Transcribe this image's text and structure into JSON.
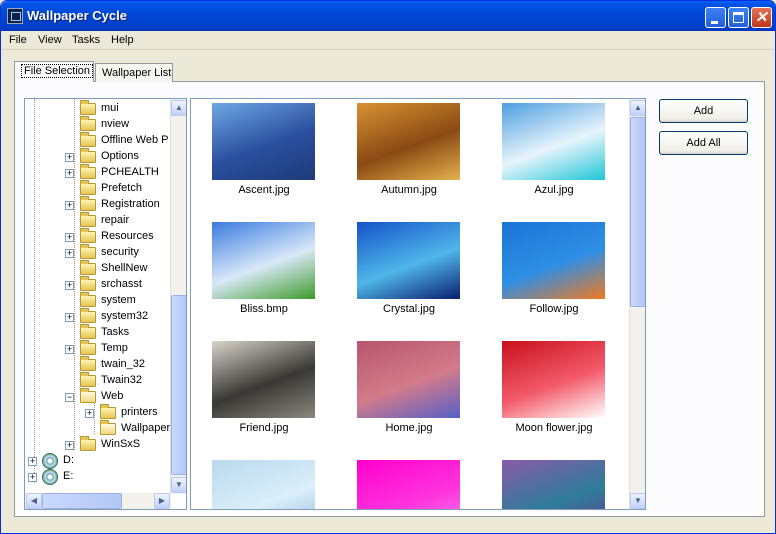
{
  "window": {
    "title": "Wallpaper Cycle"
  },
  "titlebar": {
    "icons": [
      "minimize-icon",
      "maximize-icon",
      "close-icon"
    ]
  },
  "menu": [
    "File",
    "View",
    "Tasks",
    "Help"
  ],
  "tabs": [
    {
      "label": "File Selection",
      "active": true
    },
    {
      "label": "Wallpaper List",
      "active": false
    }
  ],
  "tree": {
    "items": [
      {
        "label": "mui",
        "expandable": false
      },
      {
        "label": "nview",
        "expandable": false
      },
      {
        "label": "Offline Web P",
        "expandable": false
      },
      {
        "label": "Options",
        "expandable": true
      },
      {
        "label": "PCHEALTH",
        "expandable": true
      },
      {
        "label": "Prefetch",
        "expandable": false
      },
      {
        "label": "Registration",
        "expandable": true
      },
      {
        "label": "repair",
        "expandable": false
      },
      {
        "label": "Resources",
        "expandable": true
      },
      {
        "label": "security",
        "expandable": true
      },
      {
        "label": "ShellNew",
        "expandable": false
      },
      {
        "label": "srchasst",
        "expandable": true
      },
      {
        "label": "system",
        "expandable": false
      },
      {
        "label": "system32",
        "expandable": true
      },
      {
        "label": "Tasks",
        "expandable": false
      },
      {
        "label": "Temp",
        "expandable": true
      },
      {
        "label": "twain_32",
        "expandable": false
      },
      {
        "label": "Twain32",
        "expandable": false
      },
      {
        "label": "Web",
        "expandable": true,
        "expanded": true
      },
      {
        "label": "printers",
        "expandable": true,
        "child": true
      },
      {
        "label": "Wallpaper",
        "expandable": false,
        "child": true,
        "open": true
      },
      {
        "label": "WinSxS",
        "expandable": true
      }
    ],
    "drives": [
      {
        "label": "D:"
      },
      {
        "label": "E:"
      }
    ]
  },
  "gallery": {
    "images": [
      {
        "name": "Ascent.jpg",
        "colors": [
          "#6fa7e6",
          "#2a4f9d",
          "#1e3b7a"
        ]
      },
      {
        "name": "Autumn.jpg",
        "colors": [
          "#d89233",
          "#8a4a14",
          "#e5b24c"
        ]
      },
      {
        "name": "Azul.jpg",
        "colors": [
          "#4d9ee0",
          "#e8f4fb",
          "#1ec6d8"
        ]
      },
      {
        "name": "Bliss.bmp",
        "colors": [
          "#3a7be0",
          "#d9e8f7",
          "#3e9a2a"
        ]
      },
      {
        "name": "Crystal.jpg",
        "colors": [
          "#1552c9",
          "#4fb6e8",
          "#0a1f6e"
        ]
      },
      {
        "name": "Follow.jpg",
        "colors": [
          "#1a74d6",
          "#2f8fe4",
          "#f07a1f"
        ]
      },
      {
        "name": "Friend.jpg",
        "colors": [
          "#d8d4cb",
          "#3a3834",
          "#8a8780"
        ]
      },
      {
        "name": "Home.jpg",
        "colors": [
          "#b8566e",
          "#d27b8a",
          "#5560c8"
        ]
      },
      {
        "name": "Moon flower.jpg",
        "colors": [
          "#c8101e",
          "#f25a6a",
          "#ffffff"
        ]
      },
      {
        "name": "",
        "colors": [
          "#b9d9ee",
          "#dbeef9",
          "#8ebfe0"
        ]
      },
      {
        "name": "",
        "colors": [
          "#ff00cc",
          "#ff33dd",
          "#ff88ee"
        ]
      },
      {
        "name": "",
        "colors": [
          "#8a5aa8",
          "#2e7c9a",
          "#6a3a8a"
        ]
      }
    ]
  },
  "buttons": {
    "add": "Add",
    "add_all": "Add All"
  }
}
